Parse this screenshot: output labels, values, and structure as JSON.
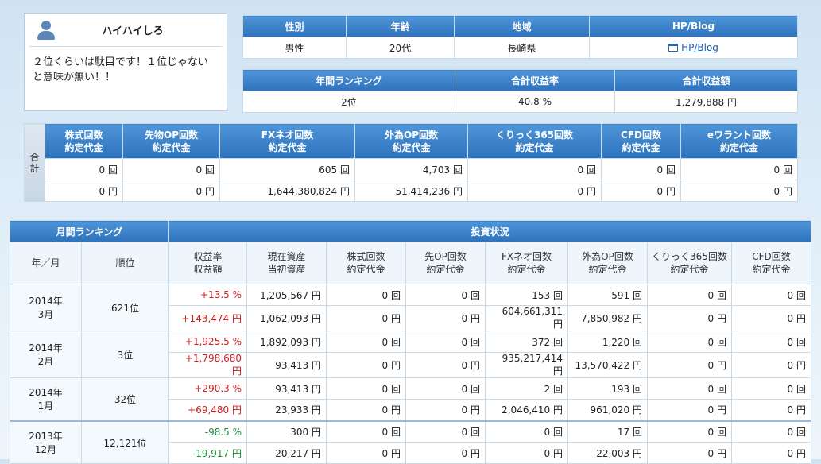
{
  "profile": {
    "name": "ハイハイしろ",
    "message_line1": "２位くらいは駄目です！１位じゃない",
    "message_line2": "と意味が無い！！"
  },
  "info": {
    "headers": [
      "性別",
      "年齢",
      "地域",
      "HP/Blog"
    ],
    "values": [
      "男性",
      "20代",
      "長崎県",
      "HP/Blog"
    ]
  },
  "annual": {
    "headers": [
      "年間ランキング",
      "合計収益率",
      "合計収益額"
    ],
    "values": [
      "2位",
      "40.8 %",
      "1,279,888 円"
    ]
  },
  "totals": {
    "side_label1": "合",
    "side_label2": "計",
    "headers": [
      {
        "l1": "株式回数",
        "l2": "約定代金"
      },
      {
        "l1": "先物OP回数",
        "l2": "約定代金"
      },
      {
        "l1": "FXネオ回数",
        "l2": "約定代金"
      },
      {
        "l1": "外為OP回数",
        "l2": "約定代金"
      },
      {
        "l1": "くりっく365回数",
        "l2": "約定代金"
      },
      {
        "l1": "CFD回数",
        "l2": "約定代金"
      },
      {
        "l1": "eワラント回数",
        "l2": "約定代金"
      }
    ],
    "counts": [
      "0 回",
      "0 回",
      "605 回",
      "4,703 回",
      "0 回",
      "0 回",
      "0 回"
    ],
    "amounts": [
      "0 円",
      "0 円",
      "1,644,380,824 円",
      "51,414,236 円",
      "0 円",
      "0 円",
      "0 円"
    ]
  },
  "monthly": {
    "group_headers": {
      "ranking": "月間ランキング",
      "status": "投資状況"
    },
    "col_headers": [
      {
        "l1": "年／月",
        "l2": ""
      },
      {
        "l1": "順位",
        "l2": ""
      },
      {
        "l1": "収益率",
        "l2": "収益額"
      },
      {
        "l1": "現在資産",
        "l2": "当初資産"
      },
      {
        "l1": "株式回数",
        "l2": "約定代金"
      },
      {
        "l1": "先OP回数",
        "l2": "約定代金"
      },
      {
        "l1": "FXネオ回数",
        "l2": "約定代金"
      },
      {
        "l1": "外為OP回数",
        "l2": "約定代金"
      },
      {
        "l1": "くりっく365回数",
        "l2": "約定代金"
      },
      {
        "l1": "CFD回数",
        "l2": "約定代金"
      }
    ],
    "rows": [
      {
        "year": "2014年",
        "month": "3月",
        "rank": "621位",
        "top": [
          "+13.5 %",
          "1,205,567 円",
          "0 回",
          "0 回",
          "153 回",
          "591 回",
          "0 回",
          "0 回"
        ],
        "bottom": [
          "+143,474 円",
          "1,062,093 円",
          "0 円",
          "0 円",
          "604,661,311 円",
          "7,850,982 円",
          "0 円",
          "0 円"
        ],
        "sign": "pos"
      },
      {
        "year": "2014年",
        "month": "2月",
        "rank": "3位",
        "top": [
          "+1,925.5 %",
          "1,892,093 円",
          "0 回",
          "0 回",
          "372 回",
          "1,220 回",
          "0 回",
          "0 回"
        ],
        "bottom": [
          "+1,798,680 円",
          "93,413 円",
          "0 円",
          "0 円",
          "935,217,414 円",
          "13,570,422 円",
          "0 円",
          "0 円"
        ],
        "sign": "pos"
      },
      {
        "year": "2014年",
        "month": "1月",
        "rank": "32位",
        "top": [
          "+290.3 %",
          "93,413 円",
          "0 回",
          "0 回",
          "2 回",
          "193 回",
          "0 回",
          "0 回"
        ],
        "bottom": [
          "+69,480 円",
          "23,933 円",
          "0 円",
          "0 円",
          "2,046,410 円",
          "961,020 円",
          "0 円",
          "0 円"
        ],
        "sign": "pos"
      },
      {
        "year": "2013年",
        "month": "12月",
        "rank": "12,121位",
        "top": [
          "-98.5 %",
          "300 円",
          "0 回",
          "0 回",
          "0 回",
          "17 回",
          "0 回",
          "0 回"
        ],
        "bottom": [
          "-19,917 円",
          "20,217 円",
          "0 円",
          "0 円",
          "0 円",
          "22,003 円",
          "0 円",
          "0 円"
        ],
        "sign": "neg"
      }
    ]
  },
  "colors": {
    "header_blue": "#2d72bd",
    "positive": "#d02020",
    "negative": "#1f8a3a",
    "link": "#1f5fad"
  },
  "icons": [
    "user-icon",
    "link-icon"
  ]
}
